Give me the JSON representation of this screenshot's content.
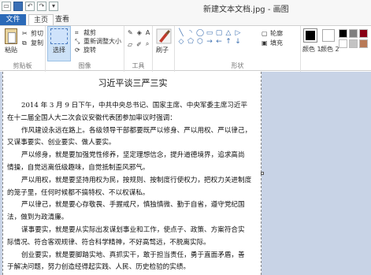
{
  "window": {
    "title": "新建文本文档.jpg - 画图"
  },
  "tabs": {
    "file": "文件",
    "home": "主页",
    "view": "查看"
  },
  "ribbon": {
    "clipboard": {
      "paste": "粘贴",
      "cut": "剪切",
      "copy": "复制",
      "label": "剪贴板"
    },
    "image": {
      "select": "选择",
      "crop": "裁剪",
      "resize": "重新调整大小",
      "rotate": "旋转",
      "label": "图像"
    },
    "tools": {
      "label": "工具"
    },
    "brushes": {
      "label": "刷子"
    },
    "shapes": {
      "outline": "轮廓",
      "fill": "填充",
      "label": "形状",
      "items": [
        "╲",
        "◝",
        "◯",
        "▭",
        "▢",
        "△",
        "▷",
        "◇",
        "⬠",
        "⬡",
        "→",
        "←",
        "↑",
        "↓"
      ]
    },
    "colors": {
      "color1": "颜色 1",
      "color2": "颜色 2",
      "color1_value": "#000000",
      "color2_value": "#ffffff",
      "palette": [
        "#000000",
        "#7f7f7f",
        "#880015",
        "#ffffff",
        "#c3c3c3",
        "#b97a57"
      ]
    }
  },
  "document": {
    "title": "习近平谈三严三实",
    "lines": [
      "2014 年 3 月 9 日下午，中共中央总书记、国家主席、中央军委主席习近平",
      "在十二届全国人大二次会议安徽代表团参加审议时强调：",
      "作风建设永远在路上。各级领导干部都要既严以修身、严以用权、严以律己，",
      "又谋事要实、创业要实、做人要实。",
      "严以修身，就是要加强党性修养，坚定理想信念，提升道德境界，追求高尚",
      "情操，自觉远离低级趣味，自觉抵制歪风邪气。",
      "严以用权，就是要坚持用权为民，按规则、按制度行使权力，把权力关进制度",
      "的笼子里，任何时候都不搞特权、不以权谋私。",
      "严以律己，就是要心存敬畏、手握戒尺，慎独慎微、勤于自省，遵守党纪国",
      "法，做到为政清廉。",
      "谋事要实，就是要从实际出发谋划事业和工作，使点子、政策、方案符合实",
      "际情况、符合客观规律、符合科学精神，不好高骛远，不脱离实际。",
      "创业要实，就是要脚踏实地、真抓实干，敢于担当责任，勇于直面矛盾，善",
      "于解决问题，努力创造经得起实践、人民、历史检验的实绩。"
    ]
  }
}
